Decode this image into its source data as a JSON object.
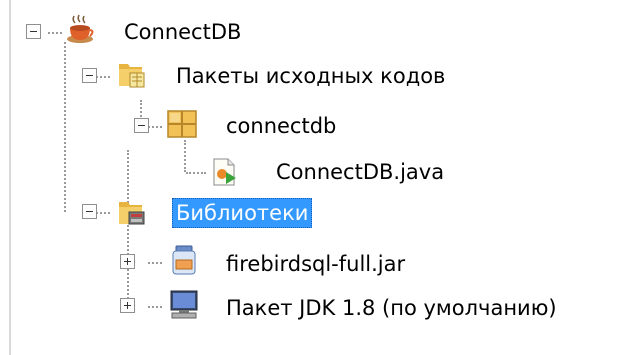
{
  "tree": {
    "root": {
      "label": "ConnectDB",
      "icon": "coffee-cup-project-icon",
      "expanded": true
    },
    "source_packages": {
      "label": "Пакеты исходных кодов",
      "icon": "source-folder-icon",
      "expanded": true
    },
    "package": {
      "label": "connectdb",
      "icon": "package-icon",
      "expanded": true
    },
    "java_file": {
      "label": "ConnectDB.java",
      "icon": "java-class-file-icon"
    },
    "libraries": {
      "label": "Библиотеки",
      "icon": "library-folder-icon",
      "expanded": true,
      "selected": true
    },
    "jar": {
      "label": "firebirdsql-full.jar",
      "icon": "jar-icon",
      "expanded": false
    },
    "jdk": {
      "label": "Пакет JDK 1.8 (по умолчанию)",
      "icon": "jdk-computer-icon",
      "expanded": false
    }
  },
  "colors": {
    "selection": "#3399ff",
    "tree_lines": "#9a9a9a"
  }
}
